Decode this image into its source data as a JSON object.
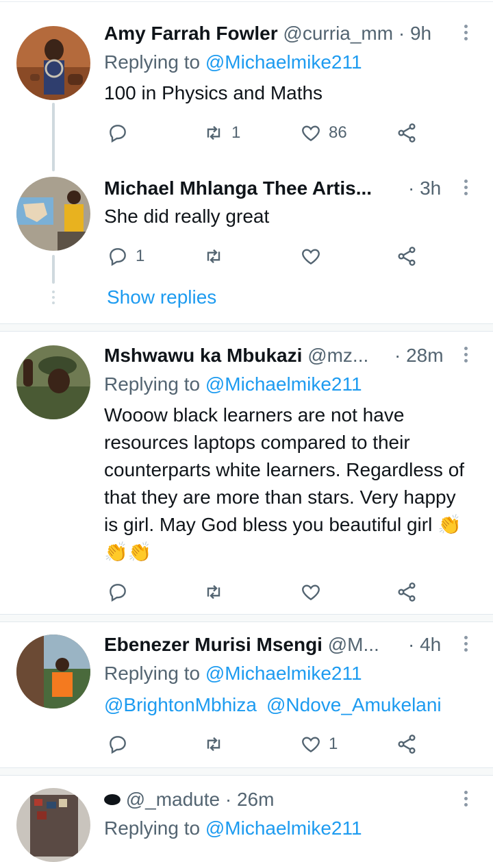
{
  "tweets": [
    {
      "name": "Amy Farrah Fowler",
      "handle": "@curria_mm",
      "time": "· 9h",
      "replying_prefix": "Replying to ",
      "replying_to": "@Michaelmike211",
      "text": "100 in Physics and Maths",
      "retweets": "1",
      "likes": "86"
    },
    {
      "name": "Michael Mhlanga Thee Artis...",
      "time": "· 3h",
      "text": "She did really great",
      "replies": "1",
      "show_replies": "Show replies"
    },
    {
      "name": "Mshwawu ka Mbukazi",
      "handle": "@mz...",
      "time": "· 28m",
      "replying_prefix": "Replying to ",
      "replying_to": "@Michaelmike211",
      "text": "Wooow black learners are not have resources laptops compared to their counterparts white learners. Regardless of that they are more than stars. Very happy is girl. May God bless you beautiful girl 👏👏👏"
    },
    {
      "name": "Ebenezer Murisi Msengi",
      "handle": "@M...",
      "time": "· 4h",
      "replying_prefix": "Replying to ",
      "replying_to": "@Michaelmike211",
      "mention1": "@BrightonMbhiza",
      "mention2": "@Ndove_Amukelani",
      "likes": "1"
    },
    {
      "name_emoji": "⬬",
      "handle": "@_madute",
      "time": "· 26m",
      "replying_prefix": "Replying to ",
      "replying_to": "@Michaelmike211"
    }
  ],
  "colors": {
    "link": "#1d9bf0",
    "secondary_text": "#536471",
    "primary_text": "#0f1419"
  },
  "icons": [
    "reply-icon",
    "retweet-icon",
    "like-icon",
    "share-icon",
    "more-icon"
  ]
}
